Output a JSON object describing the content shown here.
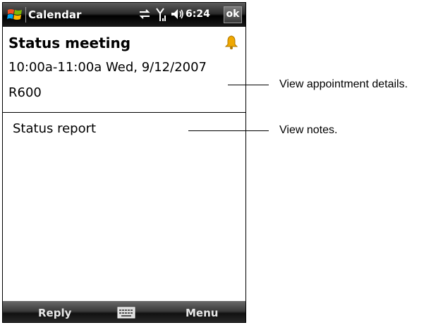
{
  "titlebar": {
    "app_title": "Calendar",
    "time": "6:24",
    "ok_label": "ok",
    "icons": [
      "windows-start-icon",
      "connectivity-icon",
      "signal-icon",
      "volume-icon"
    ]
  },
  "appointment": {
    "subject": "Status meeting",
    "time_range": "10:00a-11:00a Wed, 9/12/2007",
    "location": "R600",
    "reminder_icon": "bell-icon",
    "reminder_color": "#f0a800"
  },
  "notes": {
    "text": "Status report"
  },
  "softkeys": {
    "left": "Reply",
    "center_icon": "keyboard-icon",
    "right": "Menu"
  },
  "callouts": [
    {
      "text": "View appointment details."
    },
    {
      "text": "View notes."
    }
  ]
}
